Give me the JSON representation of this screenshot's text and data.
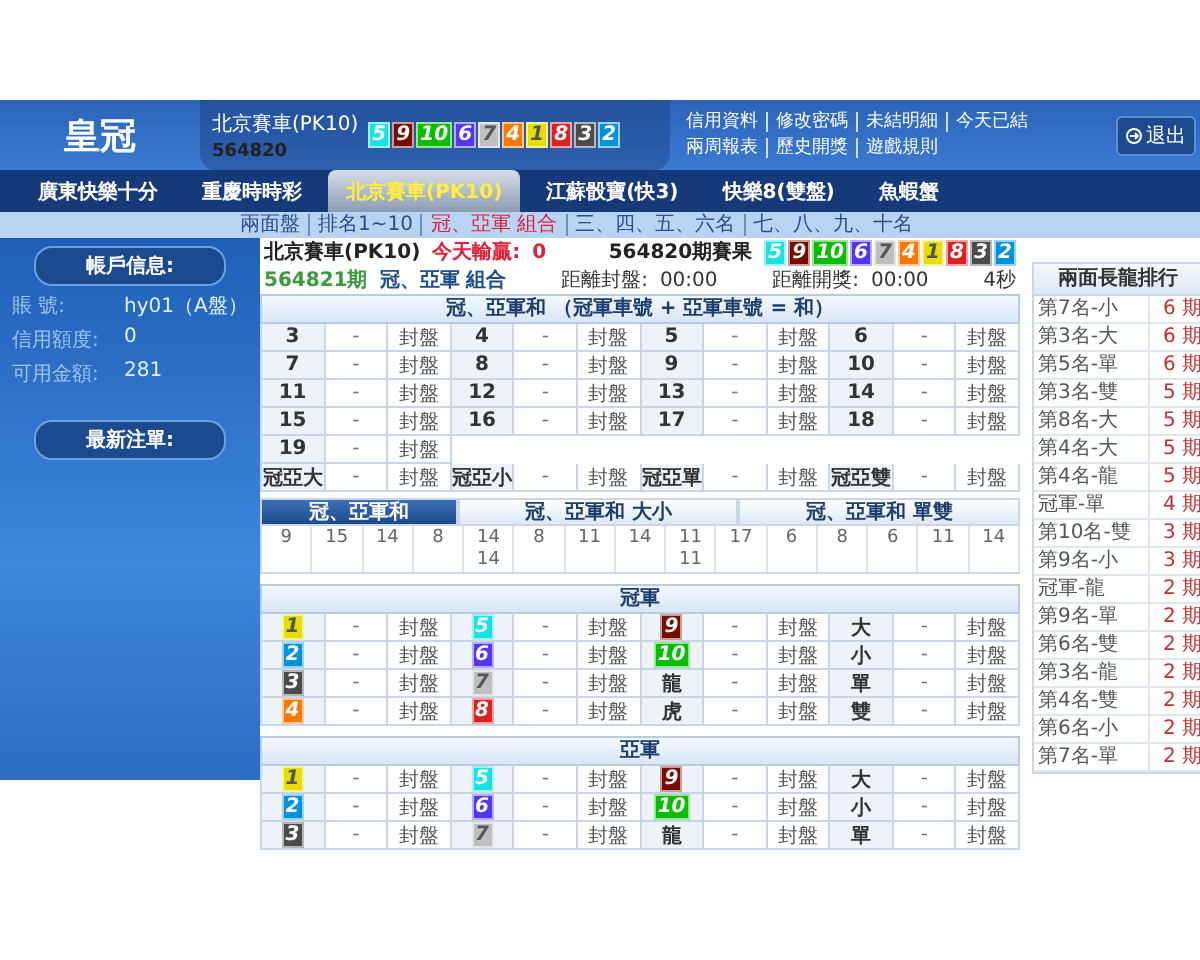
{
  "header": {
    "logo": "皇冠",
    "game": "北京賽車(PK10)",
    "draw": "564820",
    "balls": [
      {
        "number": "5",
        "color": "#17e2e5"
      },
      {
        "number": "9",
        "color": "#780b00"
      },
      {
        "number": "10",
        "color": "#07bf00"
      },
      {
        "number": "6",
        "color": "#5234ff"
      },
      {
        "number": "7",
        "color": "#bfbfbf"
      },
      {
        "number": "4",
        "color": "#ff7600"
      },
      {
        "number": "1",
        "color": "#e6de00"
      },
      {
        "number": "8",
        "color": "#e02020"
      },
      {
        "number": "3",
        "color": "#4b4b4b"
      },
      {
        "number": "2",
        "color": "#0092dd"
      }
    ],
    "links_row_1": [
      "信用資料",
      "修改密碼",
      "未結明細",
      "今天已結"
    ],
    "links_row_2": [
      "兩周報表",
      "歷史開獎",
      "遊戲規則"
    ],
    "logout": "退出"
  },
  "nav": {
    "items": [
      {
        "label": "廣東快樂十分",
        "selected": false
      },
      {
        "label": "重慶時時彩",
        "selected": false
      },
      {
        "label": "北京賽車(PK10)",
        "selected": true
      },
      {
        "label": "江蘇骰寶(快3)",
        "selected": false
      },
      {
        "label": "快樂8(雙盤)",
        "selected": false
      },
      {
        "label": "魚蝦蟹",
        "selected": false
      }
    ]
  },
  "subnav": {
    "items": [
      {
        "label": "兩面盤",
        "selected": false
      },
      {
        "label": "排名1~10",
        "selected": false
      },
      {
        "label": "冠、亞軍 組合",
        "selected": true
      },
      {
        "label": "三、四、五、六名",
        "selected": false
      },
      {
        "label": "七、八、九、十名",
        "selected": false
      }
    ]
  },
  "sidebar": {
    "account_title": "帳戶信息:",
    "fields": [
      {
        "label": "賬 號:",
        "value": "hy01（A盤）"
      },
      {
        "label": "信用額度:",
        "value": "0"
      },
      {
        "label": "可用金額:",
        "value": "281"
      }
    ],
    "recent_title": "最新注單:"
  },
  "main": {
    "game": "北京賽車(PK10)",
    "today_label": "今天輸贏:",
    "today_value": "0",
    "result_label": "564820期賽果",
    "result_balls": [
      {
        "number": "5",
        "color": "#17e2e5"
      },
      {
        "number": "9",
        "color": "#780b00"
      },
      {
        "number": "10",
        "color": "#07bf00"
      },
      {
        "number": "6",
        "color": "#5234ff"
      },
      {
        "number": "7",
        "color": "#bfbfbf"
      },
      {
        "number": "4",
        "color": "#ff7600"
      },
      {
        "number": "1",
        "color": "#e6de00"
      },
      {
        "number": "8",
        "color": "#e02020"
      },
      {
        "number": "3",
        "color": "#4b4b4b"
      },
      {
        "number": "2",
        "color": "#0092dd"
      }
    ],
    "current_draw": "564821期",
    "bet_type": "冠、亞軍 組合",
    "close_label": "距離封盤:",
    "close_time": "00:00",
    "open_label": "距離開獎:",
    "open_time": "00:00",
    "countdown": "4秒"
  },
  "sum_table": {
    "title": "冠、亞軍和 （冠軍車號 + 亞軍車號 = 和）",
    "rows": [
      [
        {
          "label": "3",
          "odds": "-",
          "status": "封盤"
        },
        {
          "label": "4",
          "odds": "-",
          "status": "封盤"
        },
        {
          "label": "5",
          "odds": "-",
          "status": "封盤"
        },
        {
          "label": "6",
          "odds": "-",
          "status": "封盤"
        }
      ],
      [
        {
          "label": "7",
          "odds": "-",
          "status": "封盤"
        },
        {
          "label": "8",
          "odds": "-",
          "status": "封盤"
        },
        {
          "label": "9",
          "odds": "-",
          "status": "封盤"
        },
        {
          "label": "10",
          "odds": "-",
          "status": "封盤"
        }
      ],
      [
        {
          "label": "11",
          "odds": "-",
          "status": "封盤"
        },
        {
          "label": "12",
          "odds": "-",
          "status": "封盤"
        },
        {
          "label": "13",
          "odds": "-",
          "status": "封盤"
        },
        {
          "label": "14",
          "odds": "-",
          "status": "封盤"
        }
      ],
      [
        {
          "label": "15",
          "odds": "-",
          "status": "封盤"
        },
        {
          "label": "16",
          "odds": "-",
          "status": "封盤"
        },
        {
          "label": "17",
          "odds": "-",
          "status": "封盤"
        },
        {
          "label": "18",
          "odds": "-",
          "status": "封盤"
        }
      ],
      [
        {
          "label": "19",
          "odds": "-",
          "status": "封盤"
        }
      ],
      [
        {
          "label": "冠亞大",
          "odds": "-",
          "status": "封盤"
        },
        {
          "label": "冠亞小",
          "odds": "-",
          "status": "封盤"
        },
        {
          "label": "冠亞單",
          "odds": "-",
          "status": "封盤"
        },
        {
          "label": "冠亞雙",
          "odds": "-",
          "status": "封盤"
        }
      ]
    ]
  },
  "road": {
    "tabs": [
      {
        "label": "冠、亞軍和",
        "selected": true
      },
      {
        "label": "冠、亞軍和 大小",
        "selected": false
      },
      {
        "label": "冠、亞軍和 單雙",
        "selected": false
      }
    ],
    "columns": [
      [
        "9"
      ],
      [
        "15"
      ],
      [
        "14"
      ],
      [
        "8"
      ],
      [
        "14",
        "14"
      ],
      [
        "8"
      ],
      [
        "11"
      ],
      [
        "14"
      ],
      [
        "11",
        "11"
      ],
      [
        "17"
      ],
      [
        "6"
      ],
      [
        "8"
      ],
      [
        "6"
      ],
      [
        "11"
      ],
      [
        "14"
      ]
    ]
  },
  "positions": [
    {
      "title": "冠軍",
      "rows": [
        [
          {
            "kind": "ball",
            "number": "1",
            "color": "#e6de00",
            "odds": "-",
            "status": "封盤"
          },
          {
            "kind": "ball",
            "number": "5",
            "color": "#17e2e5",
            "odds": "-",
            "status": "封盤"
          },
          {
            "kind": "ball",
            "number": "9",
            "color": "#780b00",
            "odds": "-",
            "status": "封盤"
          },
          {
            "kind": "text",
            "label": "大",
            "odds": "-",
            "status": "封盤"
          }
        ],
        [
          {
            "kind": "ball",
            "number": "2",
            "color": "#0092dd",
            "odds": "-",
            "status": "封盤"
          },
          {
            "kind": "ball",
            "number": "6",
            "color": "#5234ff",
            "odds": "-",
            "status": "封盤"
          },
          {
            "kind": "ball",
            "number": "10",
            "color": "#07bf00",
            "odds": "-",
            "status": "封盤"
          },
          {
            "kind": "text",
            "label": "小",
            "odds": "-",
            "status": "封盤"
          }
        ],
        [
          {
            "kind": "ball",
            "number": "3",
            "color": "#4b4b4b",
            "odds": "-",
            "status": "封盤"
          },
          {
            "kind": "ball",
            "number": "7",
            "color": "#bfbfbf",
            "odds": "-",
            "status": "封盤"
          },
          {
            "kind": "text",
            "label": "龍",
            "odds": "-",
            "status": "封盤"
          },
          {
            "kind": "text",
            "label": "單",
            "odds": "-",
            "status": "封盤"
          }
        ],
        [
          {
            "kind": "ball",
            "number": "4",
            "color": "#ff7600",
            "odds": "-",
            "status": "封盤"
          },
          {
            "kind": "ball",
            "number": "8",
            "color": "#e02020",
            "odds": "-",
            "status": "封盤"
          },
          {
            "kind": "text",
            "label": "虎",
            "odds": "-",
            "status": "封盤"
          },
          {
            "kind": "text",
            "label": "雙",
            "odds": "-",
            "status": "封盤"
          }
        ]
      ]
    },
    {
      "title": "亞軍",
      "rows": [
        [
          {
            "kind": "ball",
            "number": "1",
            "color": "#e6de00",
            "odds": "-",
            "status": "封盤"
          },
          {
            "kind": "ball",
            "number": "5",
            "color": "#17e2e5",
            "odds": "-",
            "status": "封盤"
          },
          {
            "kind": "ball",
            "number": "9",
            "color": "#780b00",
            "odds": "-",
            "status": "封盤"
          },
          {
            "kind": "text",
            "label": "大",
            "odds": "-",
            "status": "封盤"
          }
        ],
        [
          {
            "kind": "ball",
            "number": "2",
            "color": "#0092dd",
            "odds": "-",
            "status": "封盤"
          },
          {
            "kind": "ball",
            "number": "6",
            "color": "#5234ff",
            "odds": "-",
            "status": "封盤"
          },
          {
            "kind": "ball",
            "number": "10",
            "color": "#07bf00",
            "odds": "-",
            "status": "封盤"
          },
          {
            "kind": "text",
            "label": "小",
            "odds": "-",
            "status": "封盤"
          }
        ],
        [
          {
            "kind": "ball",
            "number": "3",
            "color": "#4b4b4b",
            "odds": "-",
            "status": "封盤"
          },
          {
            "kind": "ball",
            "number": "7",
            "color": "#bfbfbf",
            "odds": "-",
            "status": "封盤"
          },
          {
            "kind": "text",
            "label": "龍",
            "odds": "-",
            "status": "封盤"
          },
          {
            "kind": "text",
            "label": "單",
            "odds": "-",
            "status": "封盤"
          }
        ]
      ]
    }
  ],
  "ranking": {
    "title": "兩面長龍排行",
    "rows": [
      {
        "name": "第7名-小",
        "count": "6 期"
      },
      {
        "name": "第3名-大",
        "count": "6 期"
      },
      {
        "name": "第5名-單",
        "count": "6 期"
      },
      {
        "name": "第3名-雙",
        "count": "5 期"
      },
      {
        "name": "第8名-大",
        "count": "5 期"
      },
      {
        "name": "第4名-大",
        "count": "5 期"
      },
      {
        "name": "第4名-龍",
        "count": "5 期"
      },
      {
        "name": "冠軍-單",
        "count": "4 期"
      },
      {
        "name": "第10名-雙",
        "count": "3 期"
      },
      {
        "name": "第9名-小",
        "count": "3 期"
      },
      {
        "name": "冠軍-龍",
        "count": "2 期"
      },
      {
        "name": "第9名-單",
        "count": "2 期"
      },
      {
        "name": "第6名-雙",
        "count": "2 期"
      },
      {
        "name": "第3名-龍",
        "count": "2 期"
      },
      {
        "name": "第4名-雙",
        "count": "2 期"
      },
      {
        "name": "第6名-小",
        "count": "2 期"
      },
      {
        "name": "第7名-單",
        "count": "2 期"
      }
    ]
  }
}
